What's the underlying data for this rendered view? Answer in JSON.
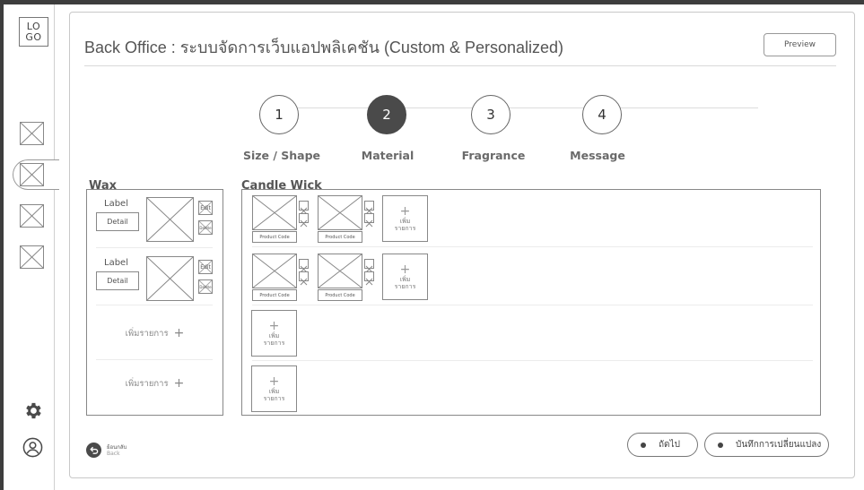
{
  "sidebar": {
    "logo": "LO GO",
    "logo_line1": "LO",
    "logo_line2": "GO"
  },
  "header": {
    "title": "Back Office : ระบบจัดการเว็บแอปพลิเคชัน (Custom & Personalized)",
    "preview_label": "Preview"
  },
  "steps": [
    {
      "number": "1",
      "label": "Size / Shape",
      "active": false
    },
    {
      "number": "2",
      "label": "Material",
      "active": true
    },
    {
      "number": "3",
      "label": "Fragrance",
      "active": false
    },
    {
      "number": "4",
      "label": "Message",
      "active": false
    }
  ],
  "wax": {
    "title": "Wax",
    "items": [
      {
        "label": "Label",
        "detail": "Detail",
        "edit": "Edit",
        "delete": "Delete"
      },
      {
        "label": "Label",
        "detail": "Detail",
        "edit": "Edit",
        "delete": "Delete"
      }
    ],
    "add_label": "เพิ่มรายการ",
    "add_plus": "+"
  },
  "wick": {
    "title": "Candle Wick",
    "product_code": "Product Code",
    "add_plus": "+",
    "add_label_line1": "เพิ่ม",
    "add_label_line2": "รายการ"
  },
  "footer": {
    "back_th": "ย้อนกลับ",
    "back_en": "Back",
    "next_label": "ถัดไป",
    "save_label": "บันทึกการเปลี่ยนแปลง"
  },
  "colors": {
    "active_step": "#4a4a4a",
    "border": "#888888"
  },
  "icons": {
    "gear": "gear-icon",
    "user": "user-icon",
    "back": "back-arrow-icon"
  }
}
